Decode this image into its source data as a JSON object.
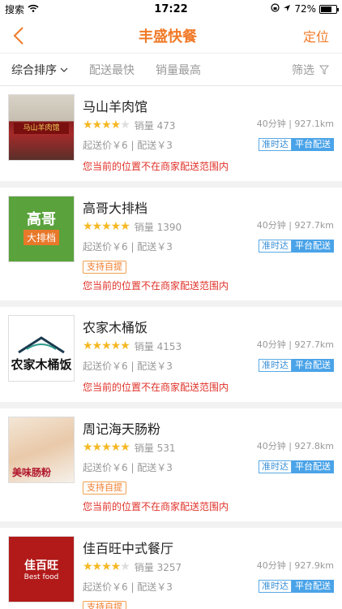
{
  "status_bar": {
    "carrier": "搜索",
    "time": "17:22",
    "battery": "72%"
  },
  "nav": {
    "title": "丰盛快餐",
    "right": "定位"
  },
  "filters": {
    "items": [
      "综合排序",
      "配送最快",
      "销量最高"
    ],
    "screen": "筛选"
  },
  "colors": {
    "accent": "#f07a28",
    "star": "#f5b823",
    "warn": "#e0322a",
    "blue": "#4aa3e8"
  },
  "shops": [
    {
      "name": "马山羊肉馆",
      "stars": 4,
      "sales": "销量 473",
      "min_delivery": "起送价￥6 | 配送￥3",
      "eta": "40分钟 | 927.1km",
      "badge_a": "准时达",
      "badge_b": "平台配送",
      "pickup": "",
      "warn": "您当前的位置不在商家配送范围内",
      "thumb_text": "马山羊肉馆"
    },
    {
      "name": "高哥大排档",
      "stars": 5,
      "sales": "销量 1390",
      "min_delivery": "起送价￥6 | 配送￥3",
      "eta": "40分钟 | 927.7km",
      "badge_a": "准时达",
      "badge_b": "平台配送",
      "pickup": "支持自提",
      "warn": "您当前的位置不在商家配送范围内",
      "thumb_text": "高哥",
      "thumb_sub": "大排档"
    },
    {
      "name": "农家木桶饭",
      "stars": 5,
      "sales": "销量 4153",
      "min_delivery": "起送价￥6 | 配送￥3",
      "eta": "40分钟 | 927.7km",
      "badge_a": "准时达",
      "badge_b": "平台配送",
      "pickup": "",
      "warn": "您当前的位置不在商家配送范围内",
      "thumb_text": "农家木桶饭"
    },
    {
      "name": "周记海天肠粉",
      "stars": 5,
      "sales": "销量 531",
      "min_delivery": "起送价￥6 | 配送￥3",
      "eta": "40分钟 | 927.8km",
      "badge_a": "准时达",
      "badge_b": "平台配送",
      "pickup": "支持自提",
      "warn": "您当前的位置不在商家配送范围内",
      "thumb_text": "美味肠粉"
    },
    {
      "name": "佳百旺中式餐厅",
      "stars": 4.5,
      "sales": "销量 3257",
      "min_delivery": "起送价￥6 | 配送￥3",
      "eta": "40分钟 | 927.9km",
      "badge_a": "准时达",
      "badge_b": "平台配送",
      "pickup": "支持自提",
      "warn": "",
      "thumb_text": "佳百旺",
      "thumb_sub": "Best food"
    }
  ]
}
